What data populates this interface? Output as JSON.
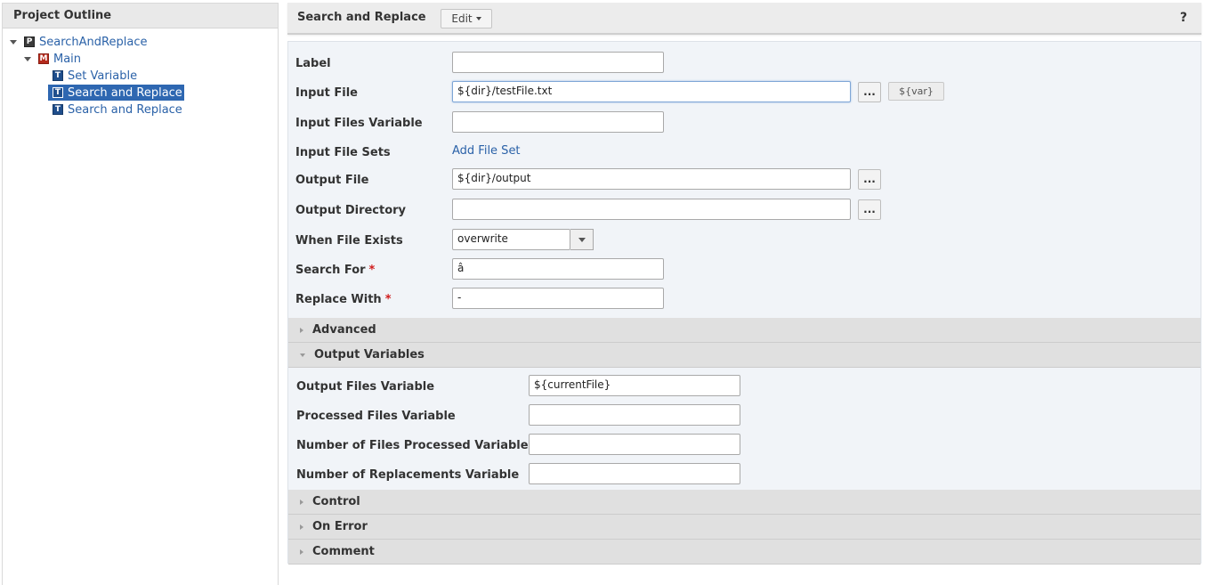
{
  "outline": {
    "title": "Project Outline",
    "items": [
      {
        "label": "SearchAndReplace",
        "icon": "P"
      },
      {
        "label": "Main",
        "icon": "M"
      },
      {
        "label": "Set Variable",
        "icon": "T"
      },
      {
        "label": "Search and Replace",
        "icon": "T",
        "selected": true
      },
      {
        "label": "Search and Replace",
        "icon": "T"
      }
    ]
  },
  "header": {
    "title": "Search and Replace",
    "edit_label": "Edit",
    "help_label": "?"
  },
  "form": {
    "label": {
      "label": "Label",
      "value": ""
    },
    "input_file": {
      "label": "Input File",
      "value": "${dir}/testFile.txt",
      "browse": "...",
      "var_button": "${var}"
    },
    "input_files_variable": {
      "label": "Input Files Variable",
      "value": ""
    },
    "input_file_sets": {
      "label": "Input File Sets",
      "link": "Add File Set"
    },
    "output_file": {
      "label": "Output File",
      "value": "${dir}/output",
      "browse": "..."
    },
    "output_directory": {
      "label": "Output Directory",
      "value": "",
      "browse": "..."
    },
    "when_file_exists": {
      "label": "When File Exists",
      "value": "overwrite"
    },
    "search_for": {
      "label": "Search For",
      "value": "â",
      "required": "*"
    },
    "replace_with": {
      "label": "Replace With",
      "value": "-",
      "required": "*"
    }
  },
  "sections": {
    "advanced": "Advanced",
    "output_variables": "Output Variables",
    "control": "Control",
    "on_error": "On Error",
    "comment": "Comment"
  },
  "output_variables": {
    "output_files_variable": {
      "label": "Output Files Variable",
      "value": "${currentFile}"
    },
    "processed_files_variable": {
      "label": "Processed Files Variable",
      "value": ""
    },
    "number_of_files_processed_variable": {
      "label": "Number of Files Processed Variable",
      "value": ""
    },
    "number_of_replacements_variable": {
      "label": "Number of Replacements Variable",
      "value": ""
    }
  },
  "colors": {
    "selection": "#2e67b1",
    "link": "#2b62a8",
    "required": "#d01c1c",
    "form_background": "#f1f4f8",
    "section_background": "#e0e0e0"
  }
}
